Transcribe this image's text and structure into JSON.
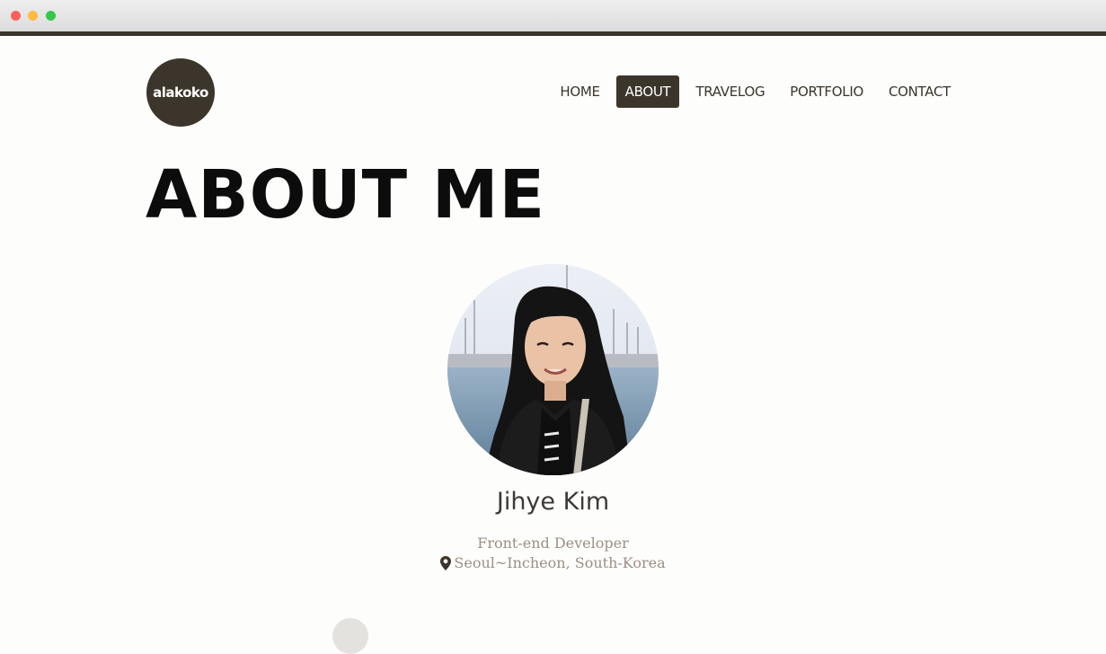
{
  "logo": {
    "text": "alakoko"
  },
  "nav": {
    "items": [
      {
        "label": "HOME",
        "active": false
      },
      {
        "label": "ABOUT",
        "active": true
      },
      {
        "label": "TRAVELOG",
        "active": false
      },
      {
        "label": "PORTFOLIO",
        "active": false
      },
      {
        "label": "CONTACT",
        "active": false
      }
    ]
  },
  "main": {
    "title": "ABOUT ME",
    "profile": {
      "name": "Jihye Kim",
      "role": "Front-end Developer",
      "location": "Seoul~Incheon, South-Korea"
    }
  },
  "icons": {
    "location": "map-marker-icon"
  },
  "colors": {
    "brand": "#3b352b",
    "page_background": "#fdfdfb",
    "muted_text": "#9c8f84"
  }
}
